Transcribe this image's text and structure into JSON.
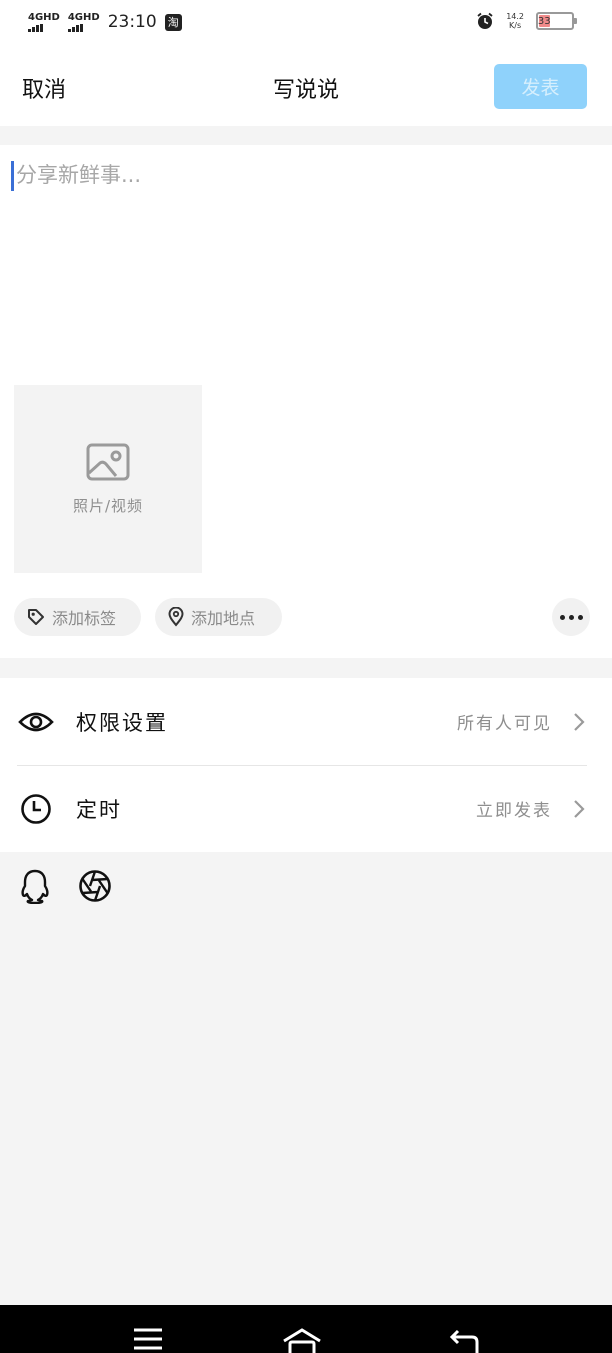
{
  "status_bar": {
    "signal_1": "4GHD",
    "signal_2": "4GHD",
    "time": "23:10",
    "taobao_icon": "淘",
    "net_speed_value": "14.2",
    "net_speed_unit": "K/s",
    "battery_level": "33",
    "battery_color": "#f08a8a"
  },
  "header": {
    "cancel_label": "取消",
    "title": "写说说",
    "publish_label": "发表",
    "publish_color": "#8fd2fb"
  },
  "composer": {
    "placeholder": "分享新鲜事...",
    "value": "",
    "media_label": "照片/视频",
    "add_tag_label": "添加标签",
    "add_location_label": "添加地点"
  },
  "settings": {
    "permission_label": "权限设置",
    "permission_value": "所有人可见",
    "schedule_label": "定时",
    "schedule_value": "立即发表"
  },
  "icons": {
    "permission": "eye-icon",
    "schedule": "clock-icon",
    "share_1": "qq-icon",
    "share_2": "aperture-icon",
    "media": "image-icon",
    "tag": "tag-icon",
    "location": "location-pin-icon",
    "more": "more-dots-icon"
  }
}
